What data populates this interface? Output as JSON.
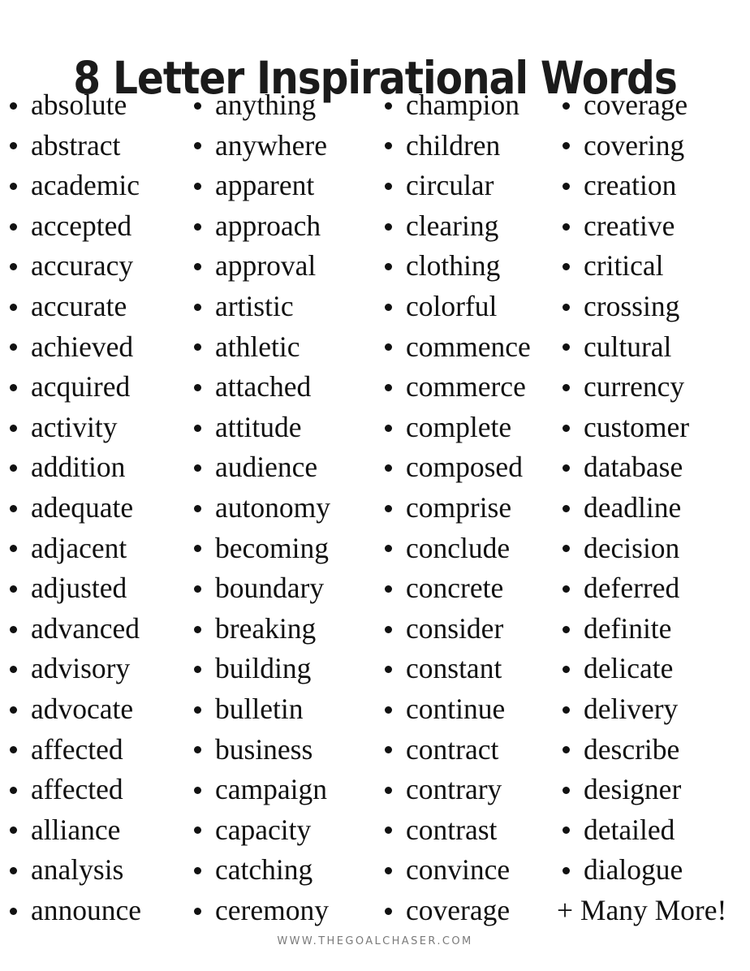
{
  "page": {
    "title": "8 Letter Inspirational Words",
    "background_color": "#ffffff",
    "text_color": "#111111",
    "footer": "WWW.THEGOALCHASER.COM",
    "footer_color": "#7b7b7b"
  },
  "columns": [
    {
      "id": "column-1",
      "words": [
        "absolute",
        "abstract",
        "academic",
        "accepted",
        "accuracy",
        "accurate",
        "achieved",
        "acquired",
        "activity",
        "addition",
        "adequate",
        "adjacent",
        "adjusted",
        "advanced",
        "advisory",
        "advocate",
        "affected",
        "affected",
        "alliance",
        "analysis",
        "announce"
      ]
    },
    {
      "id": "column-2",
      "words": [
        "anything",
        "anywhere",
        "apparent",
        "approach",
        "approval",
        "artistic",
        "athletic",
        "attached",
        "attitude",
        "audience",
        "autonomy",
        "becoming",
        "boundary",
        "breaking",
        "building",
        "bulletin",
        "business",
        "campaign",
        "capacity",
        "catching",
        "ceremony"
      ]
    },
    {
      "id": "column-3",
      "words": [
        "champion",
        "children",
        "circular",
        "clearing",
        "clothing",
        "colorful",
        "commence",
        "commerce",
        "complete",
        "composed",
        "comprise",
        "conclude",
        "concrete",
        "consider",
        "constant",
        "continue",
        "contract",
        "contrary",
        "contrast",
        "convince",
        "coverage"
      ]
    },
    {
      "id": "column-4",
      "words": [
        "coverage",
        "covering",
        "creation",
        "creative",
        "critical",
        "crossing",
        "cultural",
        "currency",
        "customer",
        "database",
        "deadline",
        "decision",
        "deferred",
        "definite",
        "delicate",
        "delivery",
        "describe",
        "designer",
        "detailed",
        "dialogue",
        "+ Many More!"
      ]
    }
  ]
}
